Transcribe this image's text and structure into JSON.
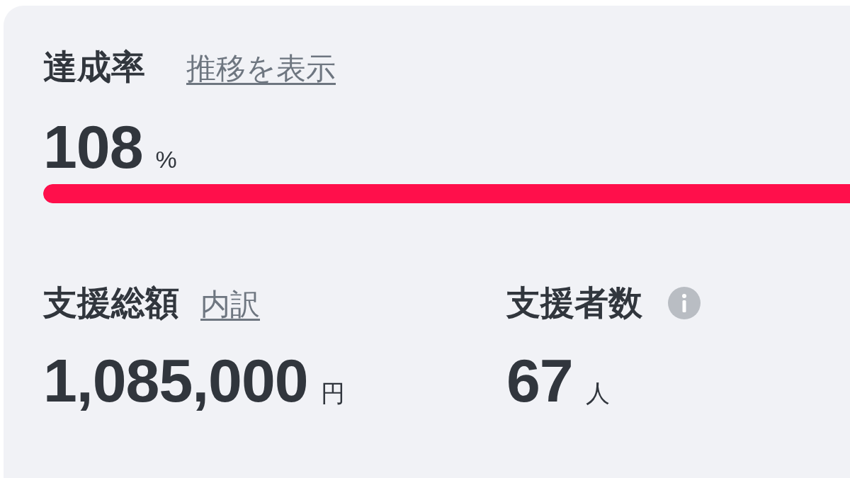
{
  "achievement": {
    "label": "達成率",
    "link": "推移を表示",
    "value": "108",
    "unit": "%",
    "level": 1
  },
  "stats": [
    {
      "label": "支援総額",
      "link": "内訳",
      "value": "1,085,000",
      "unit": "円"
    },
    {
      "label": "支援者数",
      "info": true,
      "value": "67",
      "unit": "人"
    }
  ]
}
